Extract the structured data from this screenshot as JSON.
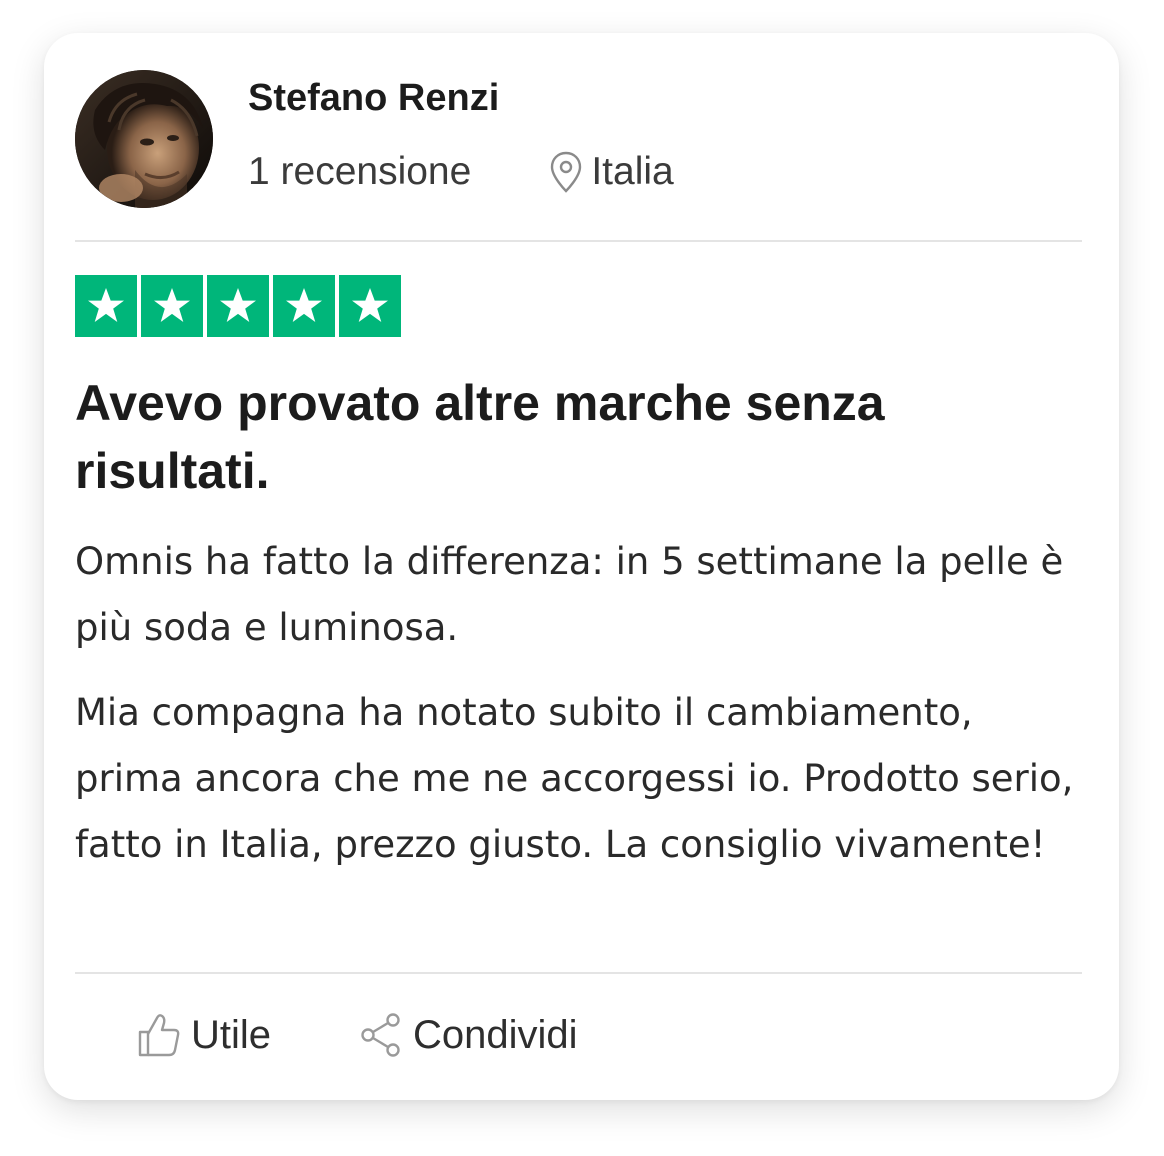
{
  "reviewer": {
    "name": "Stefano Renzi",
    "review_count": "1 recensione",
    "location": "Italia",
    "location_icon": "location-pin-icon",
    "avatar": "profile-photo"
  },
  "rating": {
    "stars": 5,
    "max": 5,
    "color": "#00b67a",
    "icon": "star-icon"
  },
  "review": {
    "title": "Avevo provato altre marche senza risultati.",
    "paragraphs": [
      "Omnis ha fatto la differenza: in 5 settimane la pelle è più soda e luminosa.",
      "Mia compagna ha notato subito il cambiamento, prima ancora che me ne accorgessi io. Prodotto serio, fatto in Italia, prezzo giusto. La consiglio vivamente!"
    ]
  },
  "actions": {
    "useful_label": "Utile",
    "useful_icon": "thumbs-up-icon",
    "share_label": "Condividi",
    "share_icon": "share-icon"
  }
}
